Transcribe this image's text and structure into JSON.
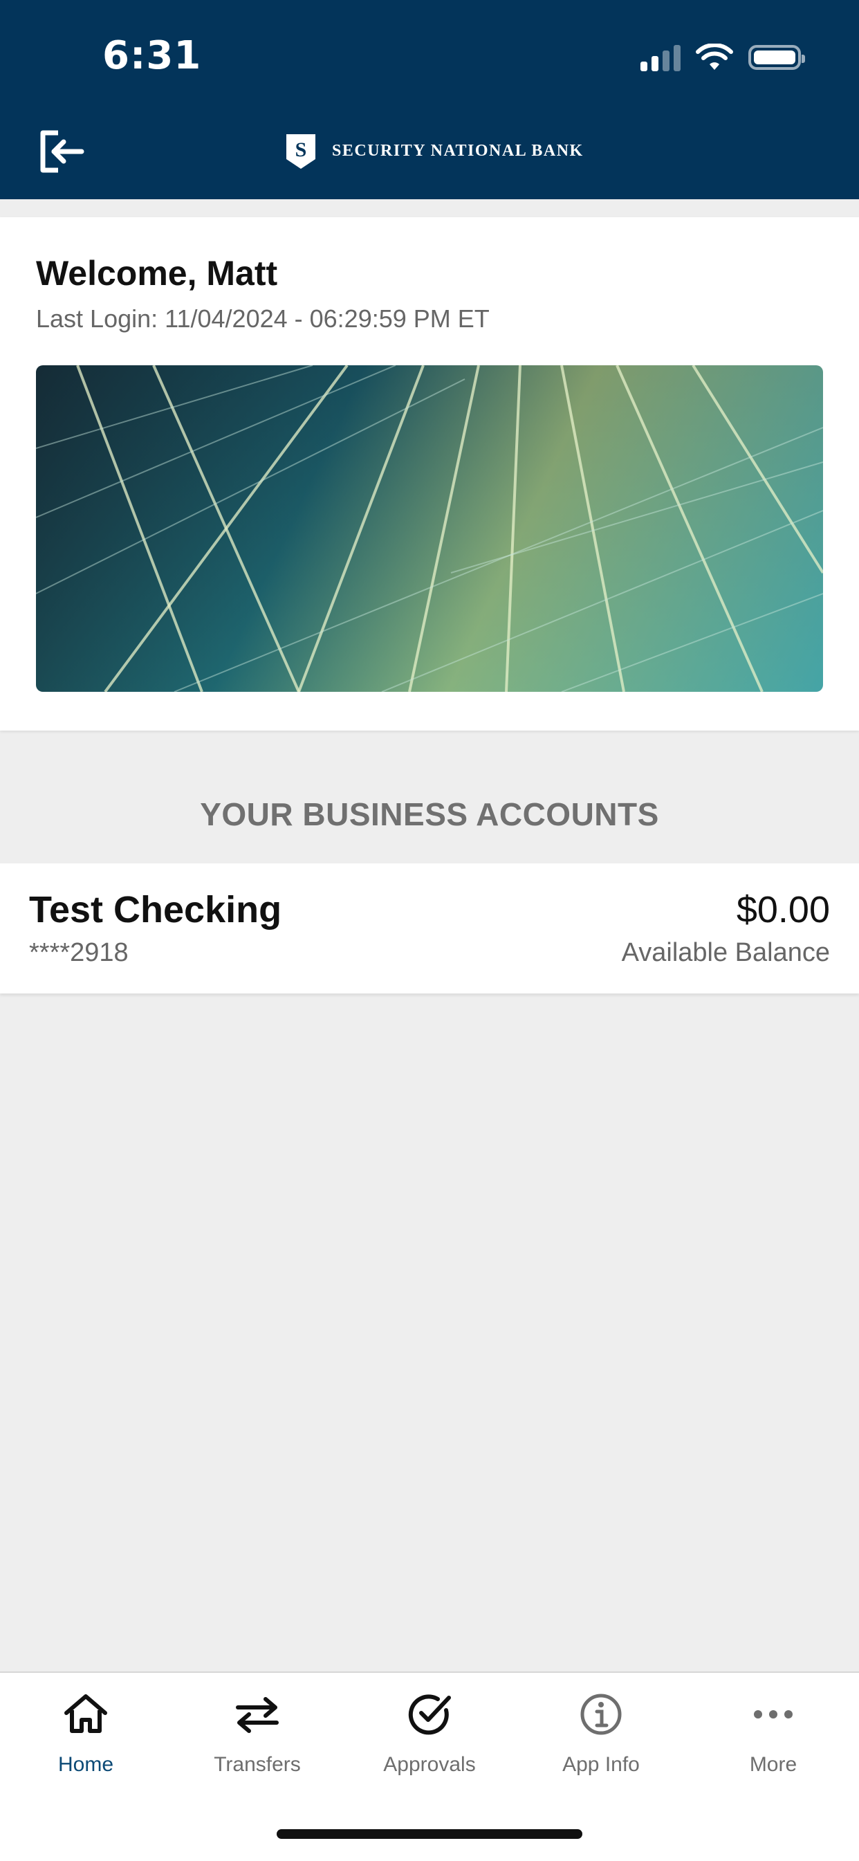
{
  "status_bar": {
    "time": "6:31"
  },
  "header": {
    "brand_name": "SECURITY NATIONAL BANK",
    "brand_initial": "S"
  },
  "welcome": {
    "title": "Welcome, Matt",
    "last_login": "Last Login: 11/04/2024 - 06:29:59 PM ET"
  },
  "accounts": {
    "section_title": "YOUR BUSINESS ACCOUNTS",
    "items": [
      {
        "name": "Test Checking",
        "number": "****2918",
        "balance": "$0.00",
        "balance_label": "Available Balance"
      }
    ]
  },
  "tabbar": {
    "items": [
      {
        "label": "Home",
        "icon": "home-icon",
        "active": true
      },
      {
        "label": "Transfers",
        "icon": "transfer-arrows-icon",
        "active": false
      },
      {
        "label": "Approvals",
        "icon": "check-circle-icon",
        "active": false
      },
      {
        "label": "App Info",
        "icon": "info-icon",
        "active": false
      },
      {
        "label": "More",
        "icon": "more-dots-icon",
        "active": false
      }
    ]
  },
  "colors": {
    "header_bg": "#03345a",
    "active_tab": "#0c4a76",
    "page_bg": "#eeeeee"
  }
}
